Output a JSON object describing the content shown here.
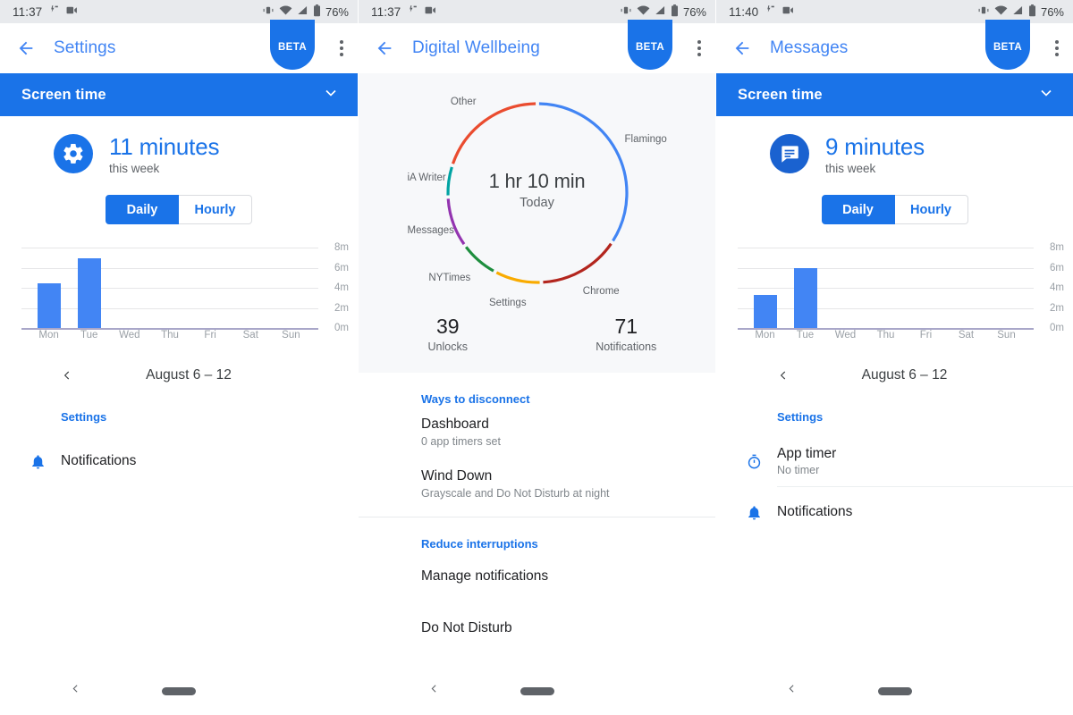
{
  "colors": {
    "accent": "#1A73E8",
    "link": "#4285F4",
    "bar": "#4285F4",
    "statusbar_bg": "#E8EAED",
    "card_bg": "#F7F8FA"
  },
  "panels": [
    {
      "id": "settings-screen-time",
      "statusbar": {
        "time": "11:37",
        "icons_left": [
          "do-not-disturb-icon",
          "screen-record-icon"
        ],
        "icons_right": [
          "vibrate-icon",
          "wifi-icon",
          "signal-icon",
          "battery-icon"
        ],
        "battery": "76%"
      },
      "appbar": {
        "back": "back-arrow-icon",
        "title": "Settings",
        "badge": "BETA",
        "overflow": "overflow-menu-icon"
      },
      "screen_time_bar": {
        "label": "Screen time",
        "chevron": "chevron-down-icon"
      },
      "summary": {
        "icon": "settings-gear-icon",
        "value": "11 minutes",
        "subtitle": "this week"
      },
      "toggle": {
        "active": "Daily",
        "inactive": "Hourly"
      },
      "week_nav": {
        "prev": "chevron-left-icon",
        "range": "August 6 – 12"
      },
      "section_title": "Settings",
      "rows": [
        {
          "icon": "bell-icon",
          "title": "Notifications",
          "sub": ""
        }
      ],
      "navbar": {
        "back": "nav-back-icon",
        "home": "home-pill"
      },
      "chart_data": {
        "type": "bar",
        "title": "Settings screen time this week",
        "categories": [
          "Mon",
          "Tue",
          "Wed",
          "Thu",
          "Fri",
          "Sat",
          "Sun"
        ],
        "values": [
          4.5,
          7.0,
          0,
          0,
          0,
          0,
          0
        ],
        "ytick_labels": [
          "8m",
          "6m",
          "4m",
          "2m",
          "0m"
        ],
        "ytick_values": [
          8,
          6,
          4,
          2,
          0
        ],
        "ylim": [
          0,
          8
        ],
        "ylabel": "",
        "xlabel": "",
        "grid": true,
        "legend": "none",
        "series_color": "#4285F4"
      }
    },
    {
      "id": "digital-wellbeing-dashboard",
      "statusbar": {
        "time": "11:37",
        "icons_left": [
          "do-not-disturb-icon",
          "screen-record-icon"
        ],
        "icons_right": [
          "vibrate-icon",
          "wifi-icon",
          "signal-icon",
          "battery-icon"
        ],
        "battery": "76%"
      },
      "appbar": {
        "back": "back-arrow-icon",
        "title": "Digital Wellbeing",
        "badge": "BETA",
        "overflow": "overflow-menu-icon"
      },
      "donut_center": {
        "value": "1 hr 10 min",
        "subtitle": "Today"
      },
      "stats": [
        {
          "num": "39",
          "cap": "Unlocks"
        },
        {
          "num": "71",
          "cap": "Notifications"
        }
      ],
      "section_title": "Ways to disconnect",
      "rows": [
        {
          "title": "Dashboard",
          "sub": "0 app timers set"
        },
        {
          "title": "Wind Down",
          "sub": "Grayscale and Do Not Disturb at night"
        }
      ],
      "section_title_2": "Reduce interruptions",
      "rows_2": [
        {
          "title": "Manage notifications",
          "sub": ""
        },
        {
          "title": "Do Not Disturb",
          "sub": ""
        }
      ],
      "navbar": {
        "back": "nav-back-icon",
        "home": "home-pill"
      },
      "chart_data": {
        "type": "pie",
        "title": "1 hr 10 min Today",
        "total_minutes": 70,
        "labels": [
          "Flamingo",
          "Chrome",
          "Settings",
          "NYTimes",
          "Messages",
          "iA Writer",
          "Other"
        ],
        "values": [
          24.0,
          10.5,
          6.0,
          5.0,
          6.5,
          4.0,
          14.0
        ],
        "colors": [
          "#4285F4",
          "#B3261E",
          "#F9AB00",
          "#1E8E3E",
          "#9334B0",
          "#00A3A3",
          "#EA4C2F"
        ],
        "legend": "around-ring",
        "donut": true
      }
    },
    {
      "id": "messages-screen-time",
      "statusbar": {
        "time": "11:40",
        "icons_left": [
          "do-not-disturb-icon",
          "screen-record-icon"
        ],
        "icons_right": [
          "vibrate-icon",
          "wifi-icon",
          "signal-icon",
          "battery-icon"
        ],
        "battery": "76%"
      },
      "appbar": {
        "back": "back-arrow-icon",
        "title": "Messages",
        "badge": "BETA",
        "overflow": "overflow-menu-icon"
      },
      "screen_time_bar": {
        "label": "Screen time",
        "chevron": "chevron-down-icon"
      },
      "summary": {
        "icon": "messages-chat-icon",
        "value": "9 minutes",
        "subtitle": "this week"
      },
      "toggle": {
        "active": "Daily",
        "inactive": "Hourly"
      },
      "week_nav": {
        "prev": "chevron-left-icon",
        "range": "August 6 – 12"
      },
      "section_title": "Settings",
      "rows": [
        {
          "icon": "timer-icon",
          "title": "App timer",
          "sub": "No timer"
        },
        {
          "icon": "bell-icon",
          "title": "Notifications",
          "sub": ""
        }
      ],
      "navbar": {
        "back": "nav-back-icon",
        "home": "home-pill"
      },
      "chart_data": {
        "type": "bar",
        "title": "Messages screen time this week",
        "categories": [
          "Mon",
          "Tue",
          "Wed",
          "Thu",
          "Fri",
          "Sat",
          "Sun"
        ],
        "values": [
          3.3,
          6.0,
          0,
          0,
          0,
          0,
          0
        ],
        "ytick_labels": [
          "8m",
          "6m",
          "4m",
          "2m",
          "0m"
        ],
        "ytick_values": [
          8,
          6,
          4,
          2,
          0
        ],
        "ylim": [
          0,
          8
        ],
        "ylabel": "",
        "xlabel": "",
        "grid": true,
        "legend": "none",
        "series_color": "#4285F4"
      }
    }
  ]
}
